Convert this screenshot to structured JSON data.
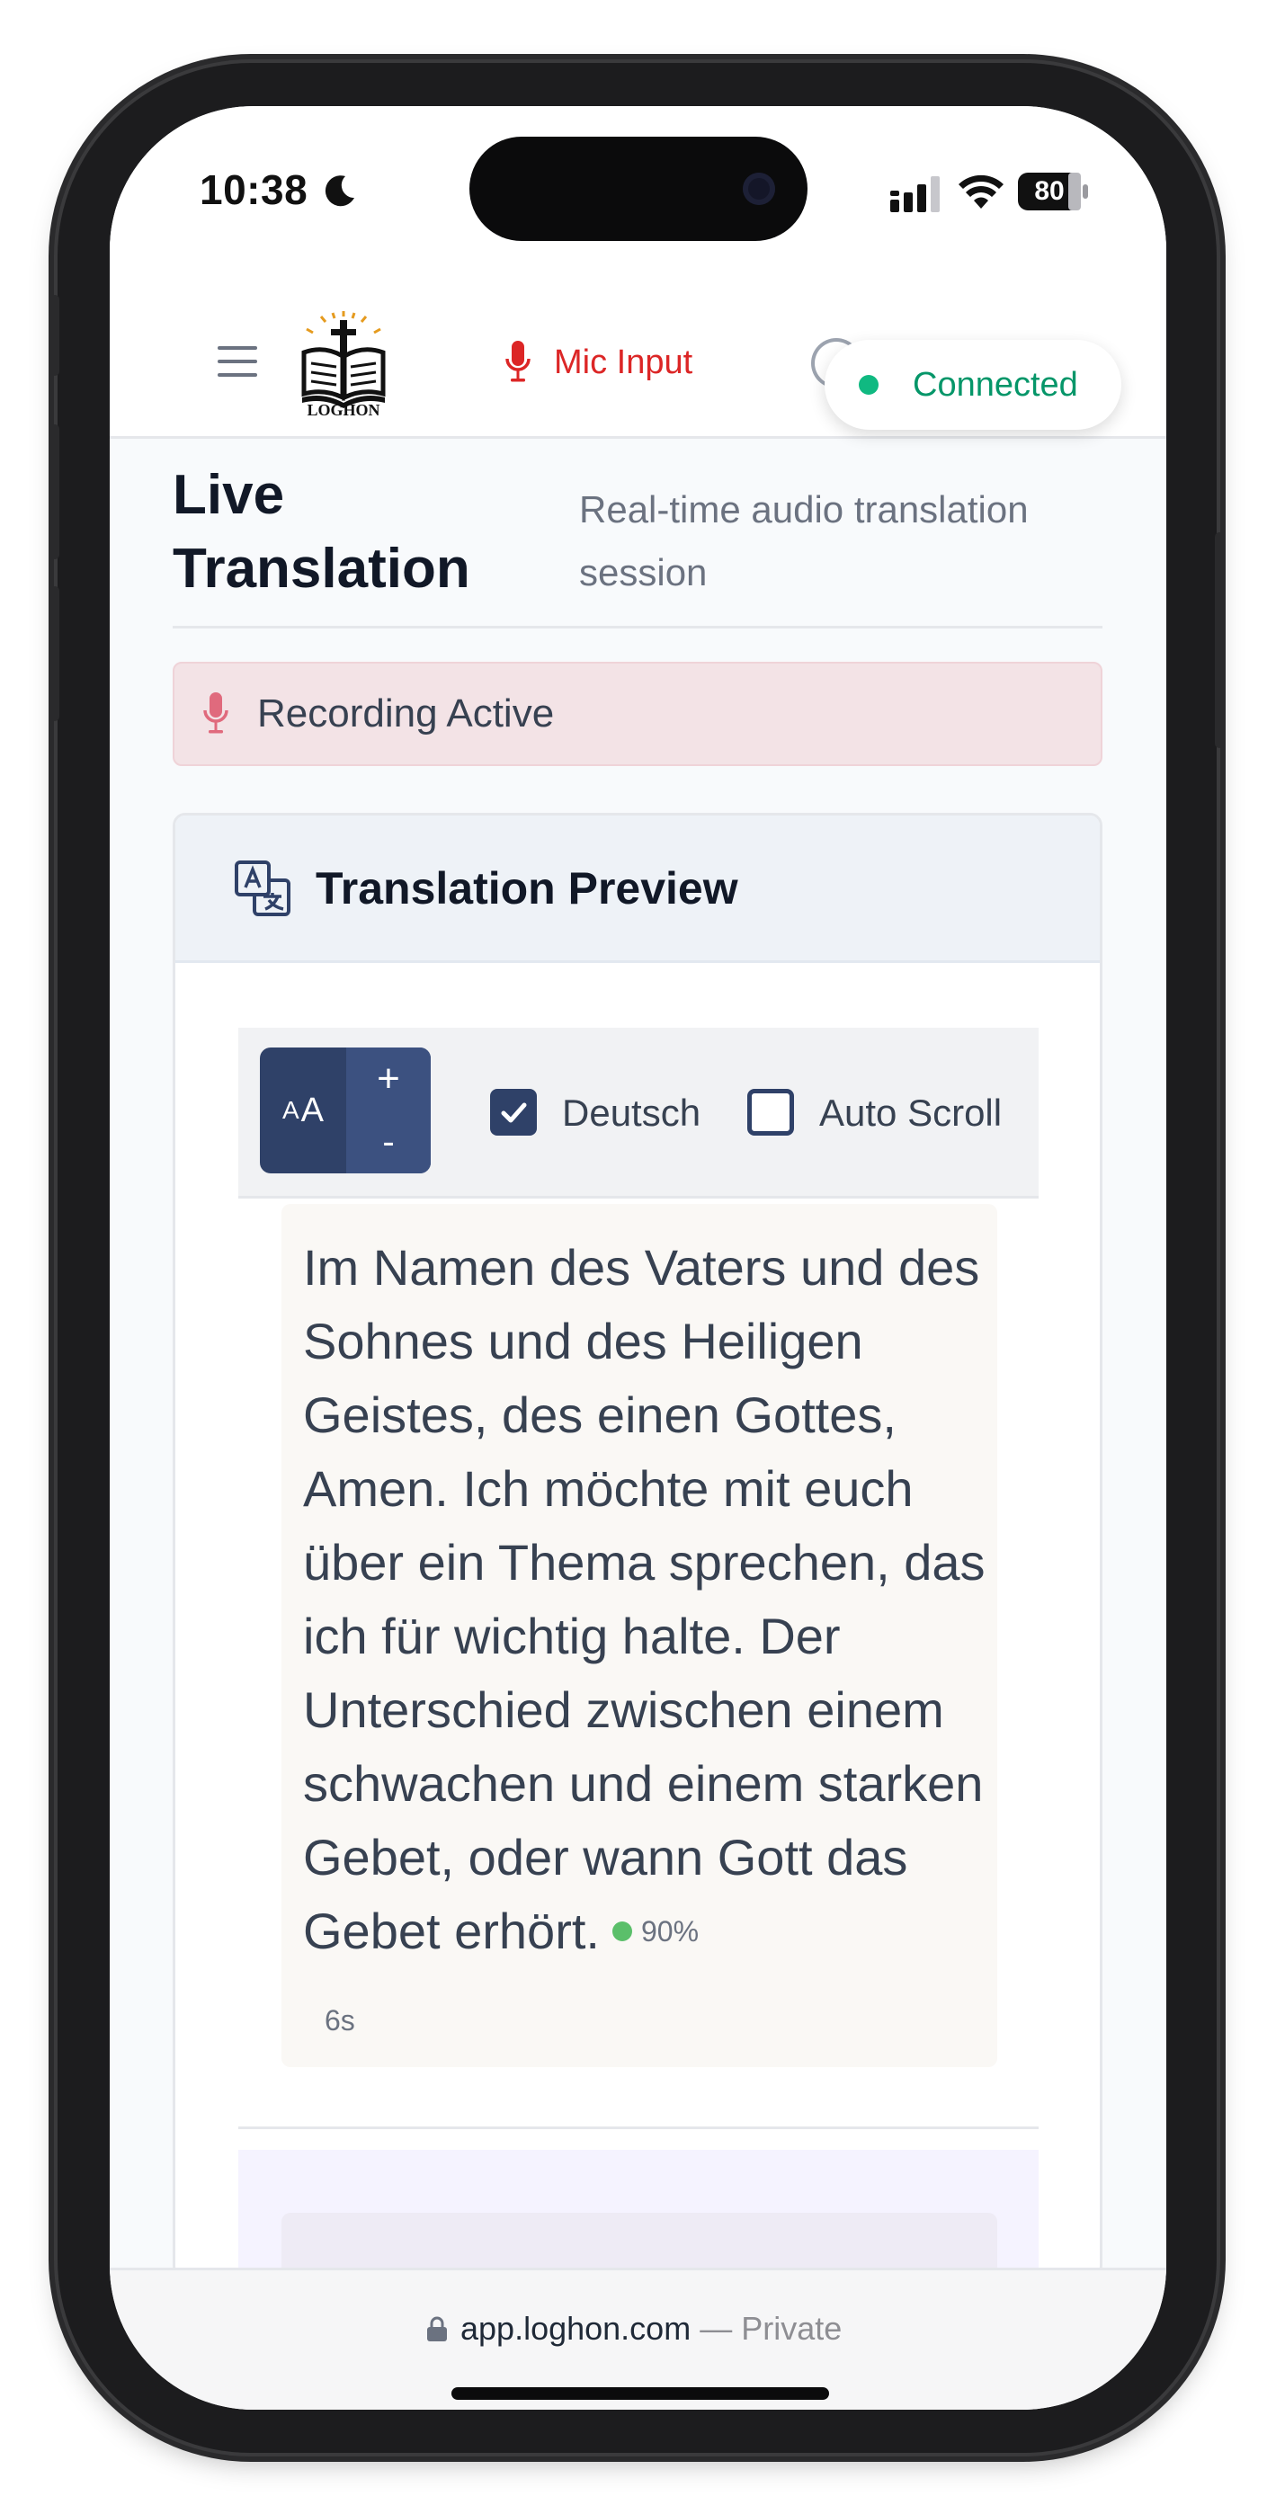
{
  "status_bar": {
    "time": "10:38",
    "battery": "80"
  },
  "header": {
    "logo_text": "LOGHON",
    "mic_label": "Mic Input",
    "connection_status": "Connected"
  },
  "page": {
    "title": "Live Translation",
    "subtitle": "Real-time audio translation session"
  },
  "recording": {
    "label": "Recording Active"
  },
  "preview": {
    "title": "Translation Preview",
    "font_control": {
      "label_small": "A",
      "label_large": "A",
      "increase": "+",
      "decrease": "-"
    },
    "options": {
      "language_label": "Deutsch",
      "language_checked": true,
      "autoscroll_label": "Auto Scroll",
      "autoscroll_checked": false
    },
    "segment": {
      "text": "Im Namen des Vaters und des Sohnes und des Heiligen Geistes, des einen Gottes, Amen. Ich möchte mit euch über ein Thema sprechen, das ich für wichtig halte. Der Unterschied zwischen einem schwachen und einem starken Gebet, oder wann Gott das Gebet erhört.",
      "confidence": "90%",
      "timestamp": "6s"
    }
  },
  "browser": {
    "domain": "app.loghon.com",
    "mode": "— Private"
  },
  "colors": {
    "accent_navy": "#2f4168",
    "danger_red": "#dc2626",
    "success_green": "#10b981",
    "recording_bg": "#f3e3e6",
    "confidence_dot": "#5bbf6a"
  },
  "icons": [
    "moon-icon",
    "signal-icon",
    "wifi-icon",
    "battery-icon",
    "menu-icon",
    "logo-bible-icon",
    "microphone-icon",
    "translate-icon",
    "checkmark-icon",
    "lock-icon"
  ]
}
